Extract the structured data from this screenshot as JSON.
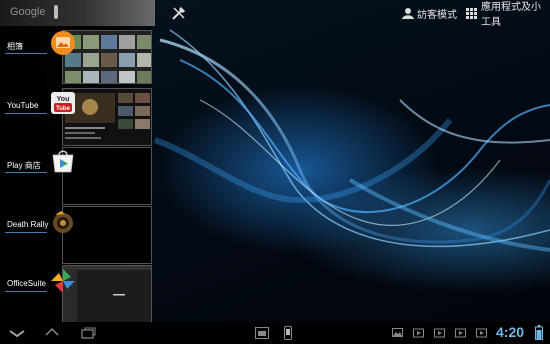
{
  "top_bar": {
    "search_brand": "Google",
    "guest_mode_label": "訪客模式",
    "apps_widgets_label": "應用程式及小工具"
  },
  "recent_apps": [
    {
      "label": "相簿",
      "icon": "gallery-icon"
    },
    {
      "label": "YouTube",
      "icon": "youtube-icon"
    },
    {
      "label": "Play 商店",
      "icon": "play-store-icon"
    },
    {
      "label": "Death Rally",
      "icon": "death-rally-icon"
    },
    {
      "label": "OfficeSuite",
      "icon": "officesuite-icon"
    }
  ],
  "nav_bar": {
    "clock": "4:20",
    "buttons": [
      "back-icon",
      "home-icon",
      "recent-apps-icon"
    ],
    "status_icons": [
      "screenshot-icon",
      "gallery-notification-icon",
      "video-notification-icon",
      "video-notification-icon",
      "video-notification-icon",
      "video-notification-icon",
      "battery-icon"
    ]
  },
  "colors": {
    "accent_blue": "#33b5e5",
    "clock": "#6fb6e8",
    "youtube_red": "#cc1e1e",
    "gallery_orange": "#f08c1e"
  }
}
